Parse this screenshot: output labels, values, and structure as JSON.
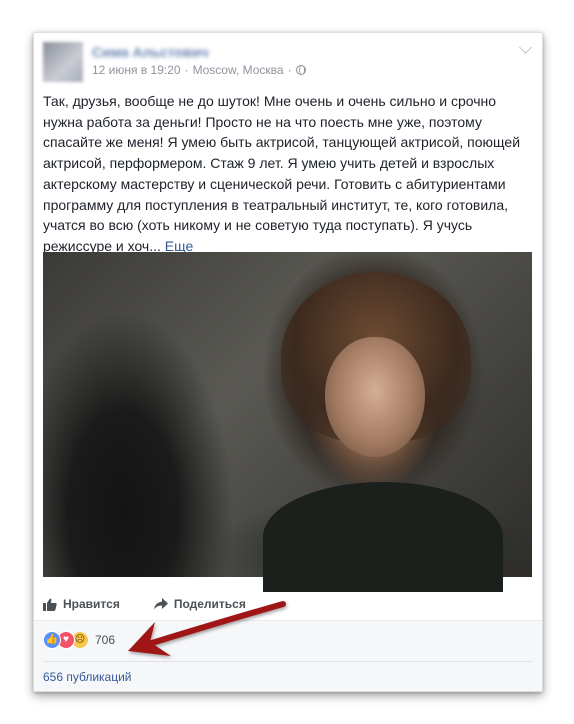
{
  "post": {
    "author": "Сима Альстович",
    "date": "12 июня в 19:20",
    "separator1": "·",
    "location": "Moscow, Москва",
    "separator2": "·",
    "privacy_icon": "globe-icon",
    "text": "Так, друзья, вообще не до шуток! Мне очень и очень сильно и срочно нужна работа за деньги! Просто не на что поесть мне уже, поэтому спасайте же меня! Я умею быть актрисой, танцующей актрисой, поющей актрисой, перформером. Стаж 9 лет. Я умею учить детей и взрослых актерскому мастерству и сценической речи. Готовить с абитуриентами программу для поступления в театральный институт, те, кого готовила, учатся во всю (хоть никому и не советую туда поступать). Я учусь режиссуре и хоч...",
    "see_more": "Еще"
  },
  "actions": {
    "like_label": "Нравится",
    "share_label": "Поделиться"
  },
  "reactions": {
    "types": [
      "like",
      "love",
      "sad"
    ],
    "count": "706"
  },
  "shares": {
    "label": "656 публикаций"
  },
  "colors": {
    "link": "#365899",
    "annotation_arrow": "#a01818"
  }
}
